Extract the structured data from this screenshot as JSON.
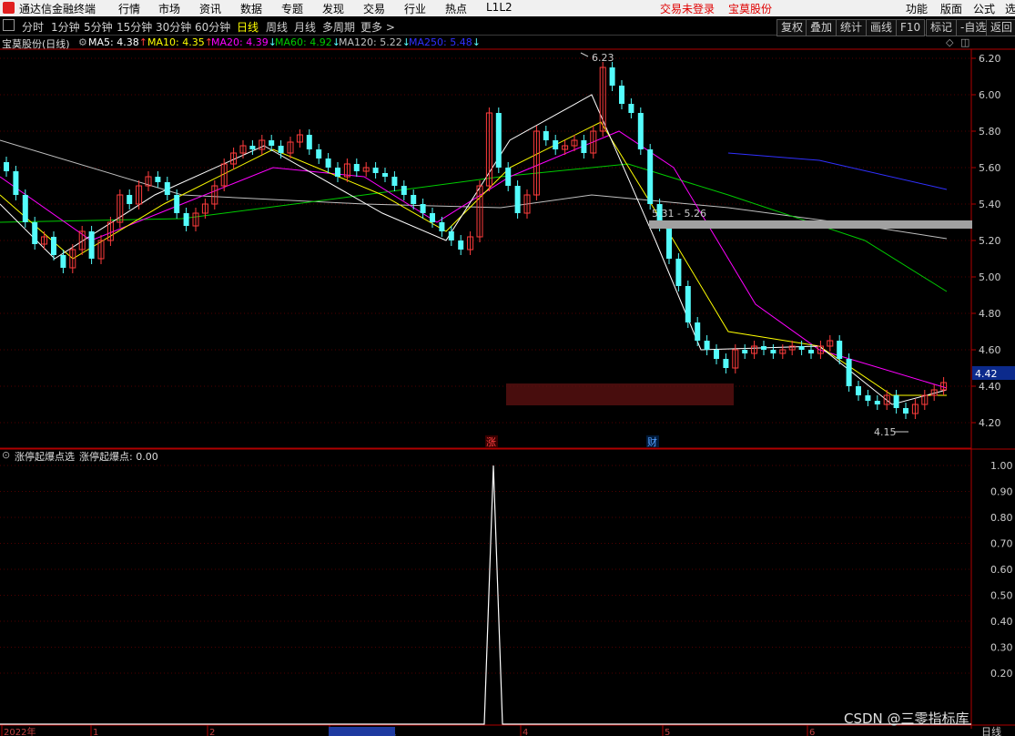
{
  "menu": {
    "app_title": "通达信金融终端",
    "items": [
      "行情",
      "市场",
      "资讯",
      "数据",
      "专题",
      "发现",
      "交易",
      "行业",
      "热点",
      "L1L2"
    ],
    "status_login": "交易未登录",
    "status_stock": "宝莫股份",
    "right_items": [
      "功能",
      "版面",
      "公式",
      "选"
    ]
  },
  "toolbar": {
    "periods": [
      "分时",
      "1分钟",
      "5分钟",
      "15分钟",
      "30分钟",
      "60分钟",
      "日线",
      "周线",
      "月线",
      "多周期",
      "更多 >"
    ],
    "active_period": "日线",
    "right_buttons": [
      "复权",
      "叠加",
      "统计",
      "画线",
      "F10",
      "标记",
      "-自选",
      "返回"
    ]
  },
  "ma_bar": {
    "stock": "宝莫股份(日线)",
    "items": [
      {
        "label": "MA5: 4.38",
        "arrow": "↑",
        "color": "#ffffff"
      },
      {
        "label": "MA10: 4.35",
        "arrow": "↑",
        "color": "#ffff00"
      },
      {
        "label": "MA20: 4.39",
        "arrow": "↓",
        "color": "#ff00ff"
      },
      {
        "label": "MA60: 4.92",
        "arrow": "↓",
        "color": "#00cc00"
      },
      {
        "label": "MA120: 5.22",
        "arrow": "↓",
        "color": "#c0c0c0"
      },
      {
        "label": "MA250: 5.48",
        "arrow": "↓",
        "color": "#3030ff"
      }
    ]
  },
  "chart": {
    "price_axis": [
      "6.20",
      "6.00",
      "5.80",
      "5.60",
      "5.40",
      "5.20",
      "5.00",
      "4.80",
      "4.60",
      "4.40",
      "4.20"
    ],
    "current_price": "4.42",
    "high_label": "6.23",
    "low_label": "4.15",
    "range_label": "5.31 - 5.26",
    "event_marks": [
      "涨",
      "财"
    ],
    "date_axis": [
      "2022年",
      "1",
      "2",
      "2023/02/24/五",
      "4",
      "5",
      "6"
    ],
    "bottom_right": "日线"
  },
  "indicator": {
    "name": "涨停起爆点选",
    "value": "涨停起爆点: 0.00",
    "axis": [
      "1.00",
      "0.90",
      "0.80",
      "0.70",
      "0.60",
      "0.50",
      "0.40",
      "0.30",
      "0.20"
    ]
  },
  "watermark": "CSDN @三零指标库",
  "colors": {
    "up": "#ff3c3c",
    "down": "#54fcfc",
    "axis": "#b00000",
    "bg": "#000000"
  }
}
